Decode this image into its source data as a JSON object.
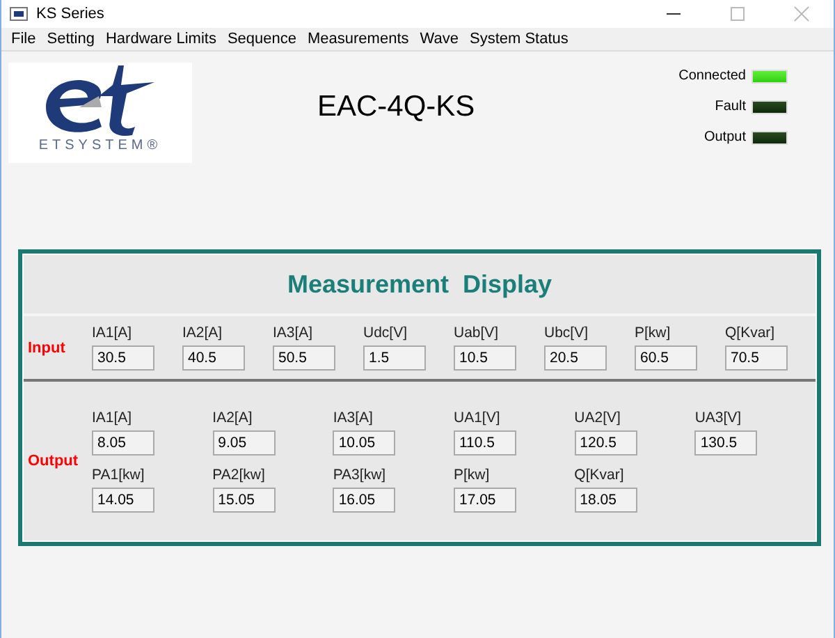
{
  "window": {
    "title": "KS Series"
  },
  "menu": [
    "File",
    "Setting",
    "Hardware Limits",
    "Sequence",
    "Measurements",
    "Wave",
    "System Status"
  ],
  "logo": {
    "text": "ETSYSTEM®"
  },
  "model": "EAC-4Q-KS",
  "indicators": [
    {
      "label": "Connected",
      "on": true
    },
    {
      "label": "Fault",
      "on": false
    },
    {
      "label": "Output",
      "on": false
    }
  ],
  "panel": {
    "title": "Measurement  Display",
    "sections": [
      {
        "label": "Input",
        "fields": [
          {
            "label": "IA1[A]",
            "value": "30.5"
          },
          {
            "label": "IA2[A]",
            "value": "40.5"
          },
          {
            "label": "IA3[A]",
            "value": "50.5"
          },
          {
            "label": "Udc[V]",
            "value": "1.5"
          },
          {
            "label": "Uab[V]",
            "value": "10.5"
          },
          {
            "label": "Ubc[V]",
            "value": "20.5"
          },
          {
            "label": "P[kw]",
            "value": "60.5"
          },
          {
            "label": "Q[Kvar]",
            "value": "70.5"
          }
        ]
      },
      {
        "label": "Output",
        "fields": [
          {
            "label": "IA1[A]",
            "value": "8.05"
          },
          {
            "label": "IA2[A]",
            "value": "9.05"
          },
          {
            "label": "IA3[A]",
            "value": "10.05"
          },
          {
            "label": "UA1[V]",
            "value": "110.5"
          },
          {
            "label": "UA2[V]",
            "value": "120.5"
          },
          {
            "label": "UA3[V]",
            "value": "130.5"
          },
          {
            "label": "PA1[kw]",
            "value": "14.05"
          },
          {
            "label": "PA2[kw]",
            "value": "15.05"
          },
          {
            "label": "PA3[kw]",
            "value": "16.05"
          },
          {
            "label": "P[kw]",
            "value": "17.05"
          },
          {
            "label": "Q[Kvar]",
            "value": "18.05"
          }
        ]
      }
    ]
  }
}
